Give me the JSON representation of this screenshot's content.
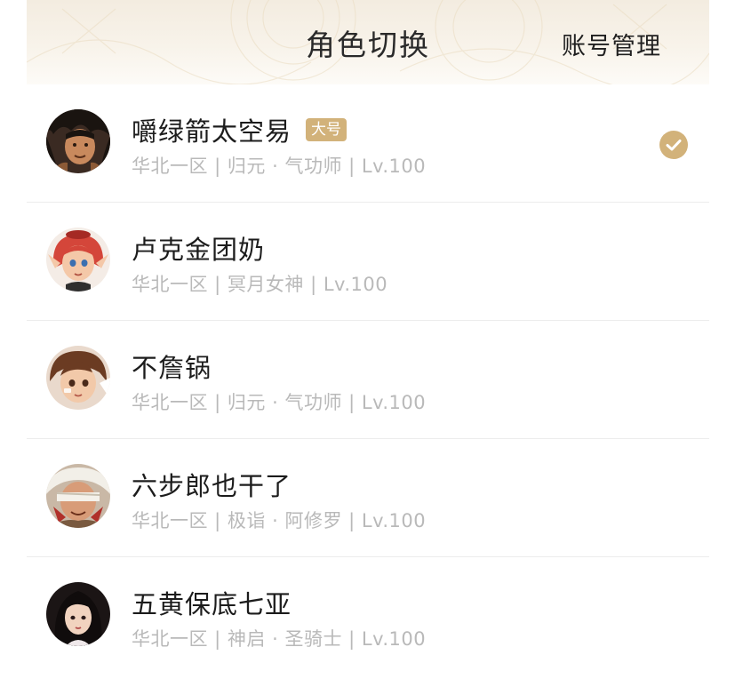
{
  "header": {
    "title": "角色切换",
    "account_label": "账号管理"
  },
  "colors": {
    "accent": "#d2b27a",
    "header_bg": "#f5efe4",
    "text_primary": "#1c1c1c",
    "text_secondary": "#b9b9b9"
  },
  "characters": [
    {
      "name": "嚼绿箭太空易",
      "badge": "大号",
      "info": "华北一区 | 归元 · 气功师 | Lv.100",
      "selected": true,
      "avatar_icon": "male-fighter-avatar"
    },
    {
      "name": "卢克金团奶",
      "info": "华北一区 | 冥月女神 | Lv.100",
      "selected": false,
      "avatar_icon": "red-hair-girl-avatar"
    },
    {
      "name": "不詹锅",
      "info": "华北一区 | 归元 · 气功师 | Lv.100",
      "selected": false,
      "avatar_icon": "brown-hair-girl-avatar"
    },
    {
      "name": "六步郎也干了",
      "info": "华北一区 | 极诣 · 阿修罗 | Lv.100",
      "selected": false,
      "avatar_icon": "blindfold-swordsman-avatar"
    },
    {
      "name": "五黄保底七亚",
      "info": "华北一区 | 神启 · 圣骑士 | Lv.100",
      "selected": false,
      "avatar_icon": "dark-hair-woman-avatar"
    }
  ]
}
